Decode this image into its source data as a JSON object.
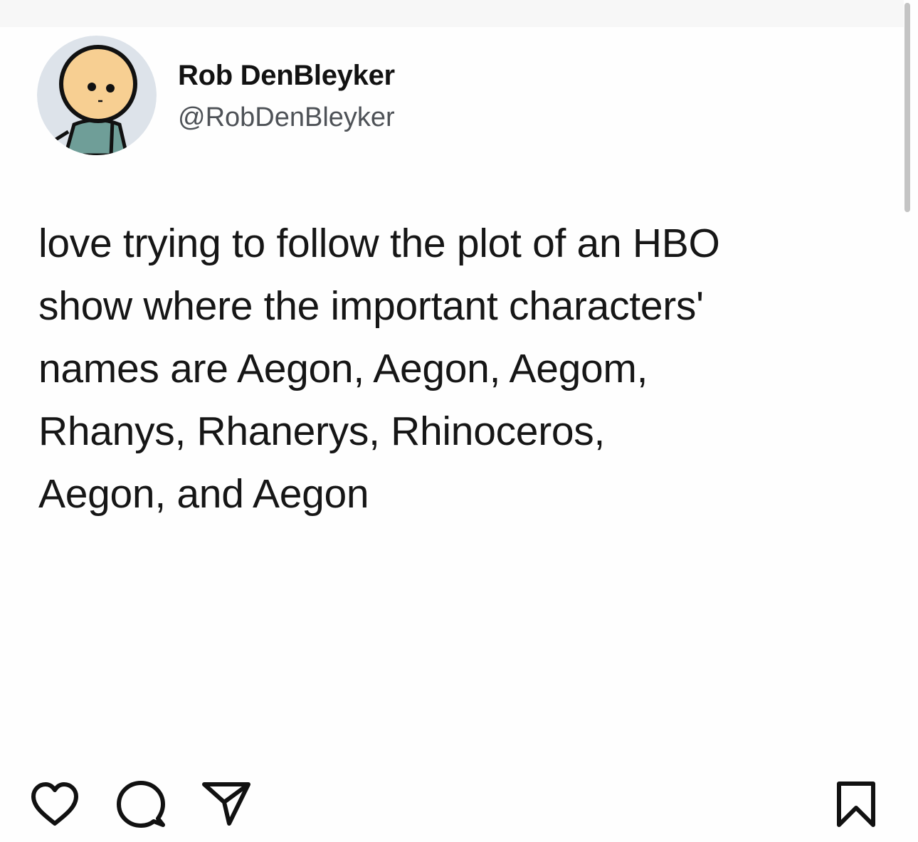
{
  "post": {
    "author": {
      "display_name": "Rob DenBleyker",
      "handle": "@RobDenBleyker",
      "avatar_icon": "cartoon-stick-figure-avatar"
    },
    "text_lines": [
      "love trying to follow the plot of an HBO",
      "show where the important characters'",
      "names are Aegon, Aegon, Aegom,",
      "Rhanys, Rhanerys, Rhinoceros,",
      "Aegon, and Aegon"
    ]
  },
  "actions": {
    "like_icon": "heart-icon",
    "comment_icon": "comment-bubble-icon",
    "share_icon": "paper-plane-icon",
    "save_icon": "bookmark-icon"
  },
  "colors": {
    "background": "#fefefe",
    "text": "#161616",
    "handle": "#4e5257",
    "avatar_background": "#dde3ea",
    "avatar_head": "#f7cf92",
    "avatar_body": "#6f9e98"
  }
}
